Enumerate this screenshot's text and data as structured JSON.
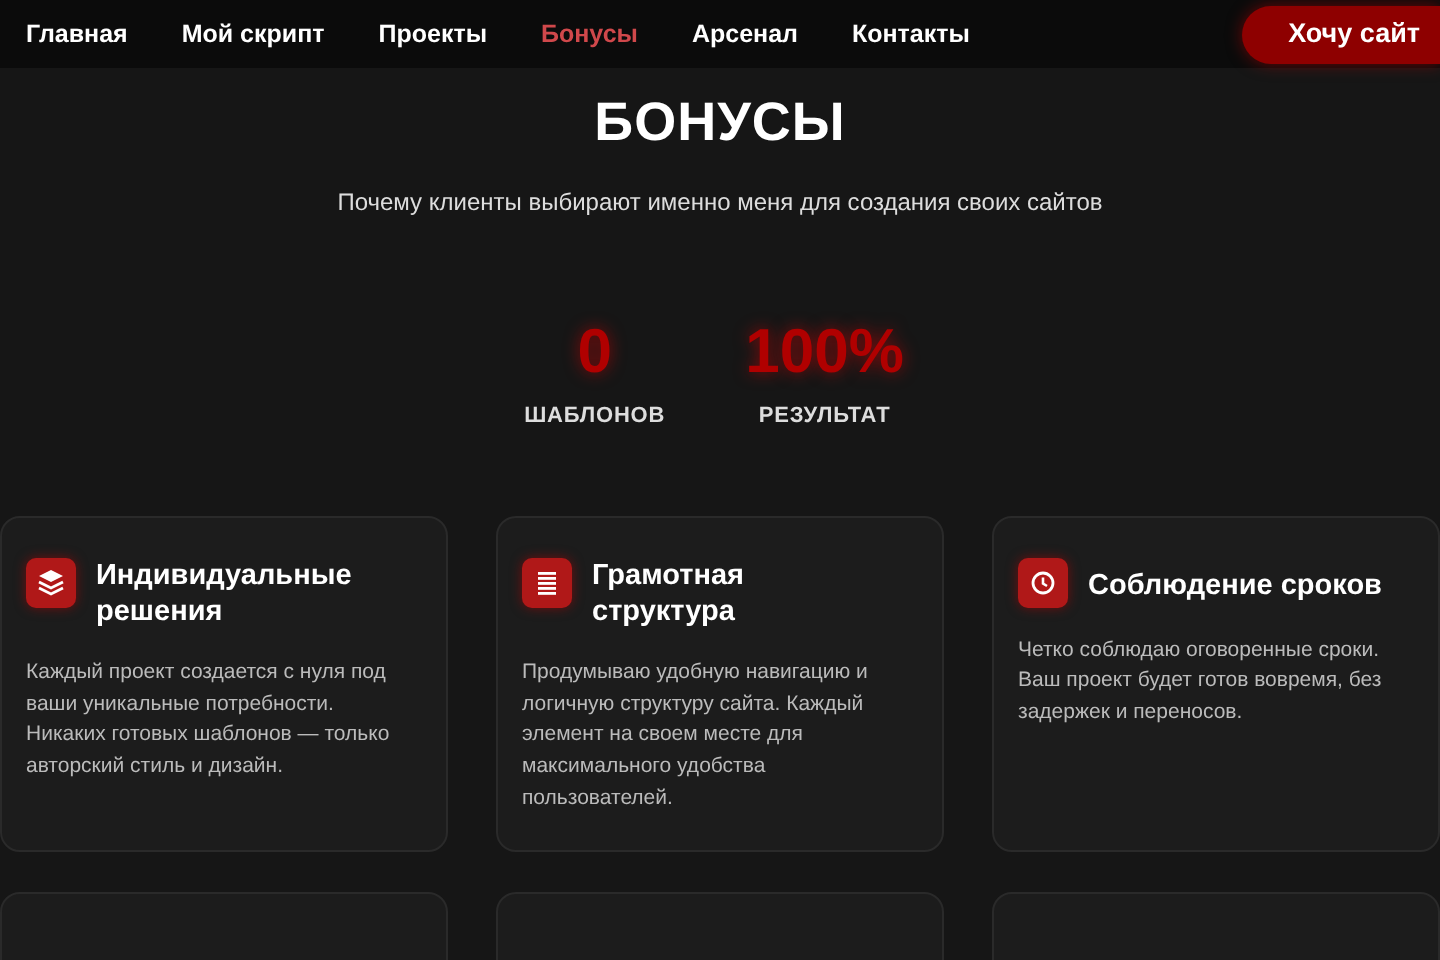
{
  "nav": {
    "items": [
      {
        "label": "Главная",
        "selected": false
      },
      {
        "label": "Мой скрипт",
        "selected": false
      },
      {
        "label": "Проекты",
        "selected": false
      },
      {
        "label": "Бонусы",
        "selected": true
      },
      {
        "label": "Арсенал",
        "selected": false
      },
      {
        "label": "Контакты",
        "selected": false
      }
    ],
    "cta": "Хочу сайт"
  },
  "section": {
    "title": "БОНУСЫ",
    "subtitle": "Почему клиенты выбирают именно меня для создания своих сайтов"
  },
  "stats": [
    {
      "value": "0",
      "label": "ШАБЛОНОВ"
    },
    {
      "value": "100%",
      "label": "РЕЗУЛЬТАТ"
    }
  ],
  "features": [
    {
      "title": "Индивидуальные решения",
      "text": "Каждый проект создается с нуля под ваши уникальные потребности. Никаких готовых шаблонов — только авторский стиль и дизайн."
    },
    {
      "title": "Грамотная структура",
      "text": "Продумываю удобную навигацию и логичную структуру сайта. Каждый элемент на своем месте для максимального удобства пользователей."
    },
    {
      "title": "Соблюдение сроков",
      "text": "Четко соблюдаю оговоренные сроки. Ваш проект будет готов вовремя, без задержек и переносов."
    }
  ]
}
